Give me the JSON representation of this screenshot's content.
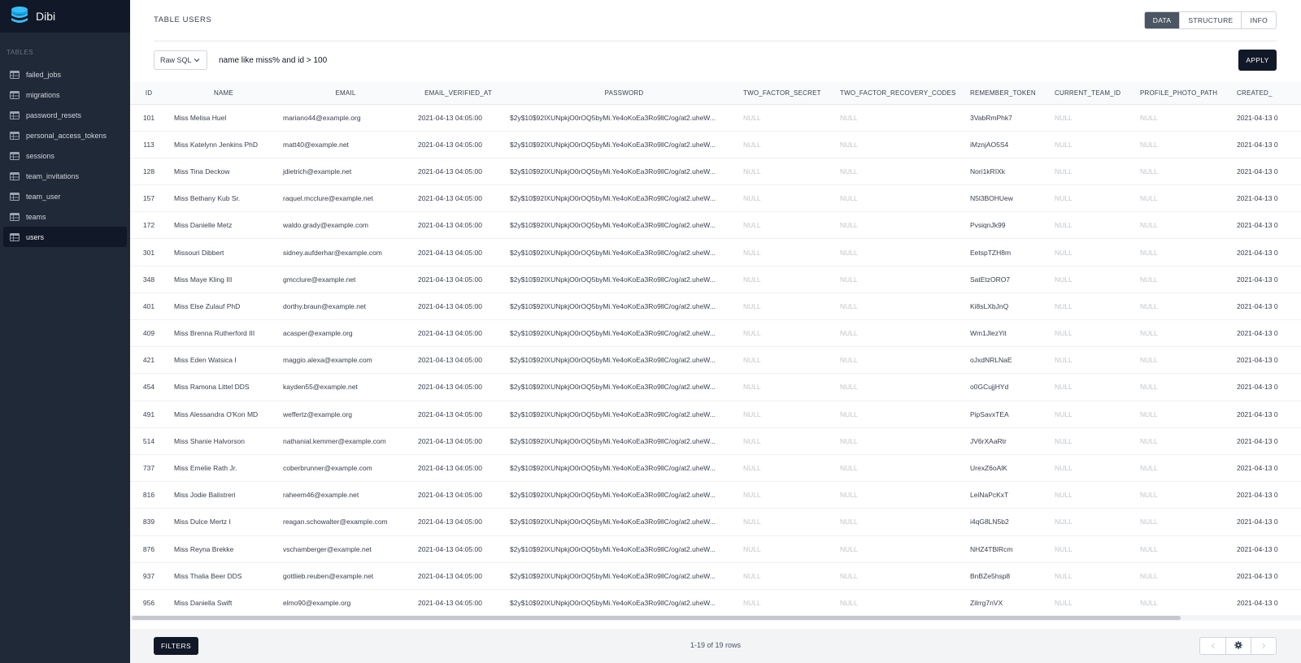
{
  "app": {
    "name": "Dibi"
  },
  "sidebar": {
    "section_label": "TABLES",
    "items": [
      {
        "label": "failed_jobs",
        "icon": "table-icon"
      },
      {
        "label": "migrations",
        "icon": "table-icon"
      },
      {
        "label": "password_resets",
        "icon": "table-icon"
      },
      {
        "label": "personal_access_tokens",
        "icon": "table-icon"
      },
      {
        "label": "sessions",
        "icon": "table-icon"
      },
      {
        "label": "team_invitations",
        "icon": "table-icon"
      },
      {
        "label": "team_user",
        "icon": "table-icon"
      },
      {
        "label": "teams",
        "icon": "table-icon"
      },
      {
        "label": "users",
        "icon": "table-icon",
        "active": true
      }
    ]
  },
  "header": {
    "title": "TABLE USERS",
    "tabs": [
      {
        "label": "DATA",
        "active": true
      },
      {
        "label": "STRUCTURE"
      },
      {
        "label": "INFO"
      }
    ]
  },
  "query": {
    "mode": "Raw SQL",
    "value": "name like miss% and id > 100",
    "apply_label": "APPLY"
  },
  "table": {
    "columns": [
      "ID",
      "NAME",
      "EMAIL",
      "EMAIL_VERIFIED_AT",
      "PASSWORD",
      "TWO_FACTOR_SECRET",
      "TWO_FACTOR_RECOVERY_CODES",
      "REMEMBER_TOKEN",
      "CURRENT_TEAM_ID",
      "PROFILE_PHOTO_PATH",
      "CREATED_"
    ],
    "rows": [
      [
        "101",
        "Miss Melisa Huel",
        "mariano44@example.org",
        "2021-04-13 04:05:00",
        "$2y$10$92IXUNpkjO0rOQ5byMi.Ye4oKoEa3Ro9llC/og/at2.uheW...",
        "NULL",
        "NULL",
        "3VabRmPhk7",
        "NULL",
        "NULL",
        "2021-04-13 0"
      ],
      [
        "113",
        "Miss Katelynn Jenkins PhD",
        "matt40@example.net",
        "2021-04-13 04:05:00",
        "$2y$10$92IXUNpkjO0rOQ5byMi.Ye4oKoEa3Ro9llC/og/at2.uheW...",
        "NULL",
        "NULL",
        "iMznjAO5S4",
        "NULL",
        "NULL",
        "2021-04-13 0"
      ],
      [
        "128",
        "Miss Tina Deckow",
        "jdietrich@example.net",
        "2021-04-13 04:05:00",
        "$2y$10$92IXUNpkjO0rOQ5byMi.Ye4oKoEa3Ro9llC/og/at2.uheW...",
        "NULL",
        "NULL",
        "Nori1kRIXk",
        "NULL",
        "NULL",
        "2021-04-13 0"
      ],
      [
        "157",
        "Miss Bethany Kub Sr.",
        "raquel.mcclure@example.net",
        "2021-04-13 04:05:00",
        "$2y$10$92IXUNpkjO0rOQ5byMi.Ye4oKoEa3Ro9llC/og/at2.uheW...",
        "NULL",
        "NULL",
        "N5l3BOHUew",
        "NULL",
        "NULL",
        "2021-04-13 0"
      ],
      [
        "172",
        "Miss Danielle Metz",
        "waldo.grady@example.com",
        "2021-04-13 04:05:00",
        "$2y$10$92IXUNpkjO0rOQ5byMi.Ye4oKoEa3Ro9llC/og/at2.uheW...",
        "NULL",
        "NULL",
        "PvsiqnJk99",
        "NULL",
        "NULL",
        "2021-04-13 0"
      ],
      [
        "301",
        "Missouri Dibbert",
        "sidney.aufderhar@example.com",
        "2021-04-13 04:05:00",
        "$2y$10$92IXUNpkjO0rOQ5byMi.Ye4oKoEa3Ro9llC/og/at2.uheW...",
        "NULL",
        "NULL",
        "EetspTZH8m",
        "NULL",
        "NULL",
        "2021-04-13 0"
      ],
      [
        "348",
        "Miss Maye Kling III",
        "gmcclure@example.net",
        "2021-04-13 04:05:00",
        "$2y$10$92IXUNpkjO0rOQ5byMi.Ye4oKoEa3Ro9llC/og/at2.uheW...",
        "NULL",
        "NULL",
        "SatEtzORO7",
        "NULL",
        "NULL",
        "2021-04-13 0"
      ],
      [
        "401",
        "Miss Else Zulauf PhD",
        "dorthy.braun@example.net",
        "2021-04-13 04:05:00",
        "$2y$10$92IXUNpkjO0rOQ5byMi.Ye4oKoEa3Ro9llC/og/at2.uheW...",
        "NULL",
        "NULL",
        "Ki8sLXbJnQ",
        "NULL",
        "NULL",
        "2021-04-13 0"
      ],
      [
        "409",
        "Miss Brenna Rutherford III",
        "acasper@example.org",
        "2021-04-13 04:05:00",
        "$2y$10$92IXUNpkjO0rOQ5byMi.Ye4oKoEa3Ro9llC/og/at2.uheW...",
        "NULL",
        "NULL",
        "Wm1JlezYit",
        "NULL",
        "NULL",
        "2021-04-13 0"
      ],
      [
        "421",
        "Miss Eden Watsica I",
        "maggio.alexa@example.com",
        "2021-04-13 04:05:00",
        "$2y$10$92IXUNpkjO0rOQ5byMi.Ye4oKoEa3Ro9llC/og/at2.uheW...",
        "NULL",
        "NULL",
        "oJxdNRLNaE",
        "NULL",
        "NULL",
        "2021-04-13 0"
      ],
      [
        "454",
        "Miss Ramona Littel DDS",
        "kayden55@example.net",
        "2021-04-13 04:05:00",
        "$2y$10$92IXUNpkjO0rOQ5byMi.Ye4oKoEa3Ro9llC/og/at2.uheW...",
        "NULL",
        "NULL",
        "o0GCujjHYd",
        "NULL",
        "NULL",
        "2021-04-13 0"
      ],
      [
        "491",
        "Miss Alessandra O'Kon MD",
        "weffertz@example.org",
        "2021-04-13 04:05:00",
        "$2y$10$92IXUNpkjO0rOQ5byMi.Ye4oKoEa3Ro9llC/og/at2.uheW...",
        "NULL",
        "NULL",
        "PipSavxTEA",
        "NULL",
        "NULL",
        "2021-04-13 0"
      ],
      [
        "514",
        "Miss Shanie Halvorson",
        "nathanial.kemmer@example.com",
        "2021-04-13 04:05:00",
        "$2y$10$92IXUNpkjO0rOQ5byMi.Ye4oKoEa3Ro9llC/og/at2.uheW...",
        "NULL",
        "NULL",
        "JV6rXAaRtr",
        "NULL",
        "NULL",
        "2021-04-13 0"
      ],
      [
        "737",
        "Miss Emelie Rath Jr.",
        "coberbrunner@example.com",
        "2021-04-13 04:05:00",
        "$2y$10$92IXUNpkjO0rOQ5byMi.Ye4oKoEa3Ro9llC/og/at2.uheW...",
        "NULL",
        "NULL",
        "UrexZ6oAlK",
        "NULL",
        "NULL",
        "2021-04-13 0"
      ],
      [
        "816",
        "Miss Jodie Balistreri",
        "raheem46@example.net",
        "2021-04-13 04:05:00",
        "$2y$10$92IXUNpkjO0rOQ5byMi.Ye4oKoEa3Ro9llC/og/at2.uheW...",
        "NULL",
        "NULL",
        "LeiNaPcKxT",
        "NULL",
        "NULL",
        "2021-04-13 0"
      ],
      [
        "839",
        "Miss Dulce Mertz I",
        "reagan.schowalter@example.com",
        "2021-04-13 04:05:00",
        "$2y$10$92IXUNpkjO0rOQ5byMi.Ye4oKoEa3Ro9llC/og/at2.uheW...",
        "NULL",
        "NULL",
        "i4qG8LN5b2",
        "NULL",
        "NULL",
        "2021-04-13 0"
      ],
      [
        "876",
        "Miss Reyna Brekke",
        "vschamberger@example.net",
        "2021-04-13 04:05:00",
        "$2y$10$92IXUNpkjO0rOQ5byMi.Ye4oKoEa3Ro9llC/og/at2.uheW...",
        "NULL",
        "NULL",
        "NHZ4TBlRcm",
        "NULL",
        "NULL",
        "2021-04-13 0"
      ],
      [
        "937",
        "Miss Thalia Beer DDS",
        "gottlieb.reuben@example.net",
        "2021-04-13 04:05:00",
        "$2y$10$92IXUNpkjO0rOQ5byMi.Ye4oKoEa3Ro9llC/og/at2.uheW...",
        "NULL",
        "NULL",
        "BnBZe5hsp8",
        "NULL",
        "NULL",
        "2021-04-13 0"
      ],
      [
        "956",
        "Miss Daniella Swift",
        "elmo90@example.org",
        "2021-04-13 04:05:00",
        "$2y$10$92IXUNpkjO0rOQ5byMi.Ye4oKoEa3Ro9llC/og/at2.uheW...",
        "NULL",
        "NULL",
        "Zilrrg7nVX",
        "NULL",
        "NULL",
        "2021-04-13 0"
      ]
    ]
  },
  "footer": {
    "filters_label": "FILTERS",
    "row_count": "1-19 of 19 rows",
    "pager": [
      {
        "icon": "chevron-left-icon",
        "disabled": true
      },
      {
        "icon": "gear-icon"
      },
      {
        "icon": "chevron-right-icon",
        "disabled": true
      }
    ]
  },
  "colors": {
    "sidebar_bg": "#1f2937",
    "brand_bg": "#111827",
    "accent_blue": "#38bdf8",
    "primary_button": "#111827",
    "null_text": "#c0c4cb"
  }
}
